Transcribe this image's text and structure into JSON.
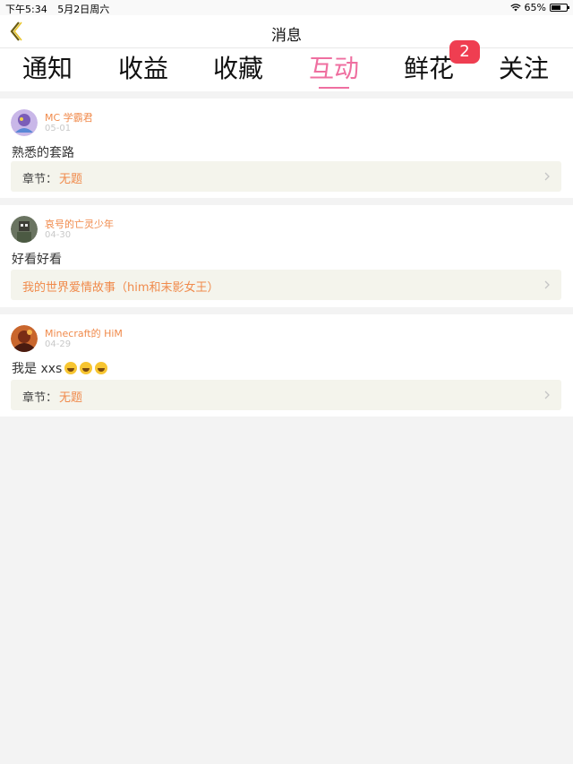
{
  "status_bar": {
    "time": "下午5:34",
    "date": "5月2日周六",
    "battery": "65%",
    "battery_level": 0.65
  },
  "header": {
    "title": "消息"
  },
  "tabs": [
    {
      "label": "通知"
    },
    {
      "label": "收益"
    },
    {
      "label": "收藏"
    },
    {
      "label": "互动",
      "active": true
    },
    {
      "label": "鲜花",
      "badge": "2"
    },
    {
      "label": "关注"
    }
  ],
  "messages": [
    {
      "user": "MC 学霸君",
      "date": "05-01",
      "content": "熟悉的套路",
      "ref_label": "章节：",
      "ref_value": "无题"
    },
    {
      "user": "哀号的亡灵少年",
      "date": "04-30",
      "content": "好看好看",
      "ref_value": "我的世界爱情故事（him和末影女王）"
    },
    {
      "user": "Minecraft的 HiM",
      "date": "04-29",
      "content": "我是 xxs",
      "emoji": "laughing-tears-emoji",
      "ref_label": "章节：",
      "ref_value": "无题"
    }
  ],
  "colors": {
    "accent": "#ef6fa0",
    "username": "#f08a4b",
    "badge": "#ef3e51",
    "ref_bg": "#f4f4ec"
  }
}
